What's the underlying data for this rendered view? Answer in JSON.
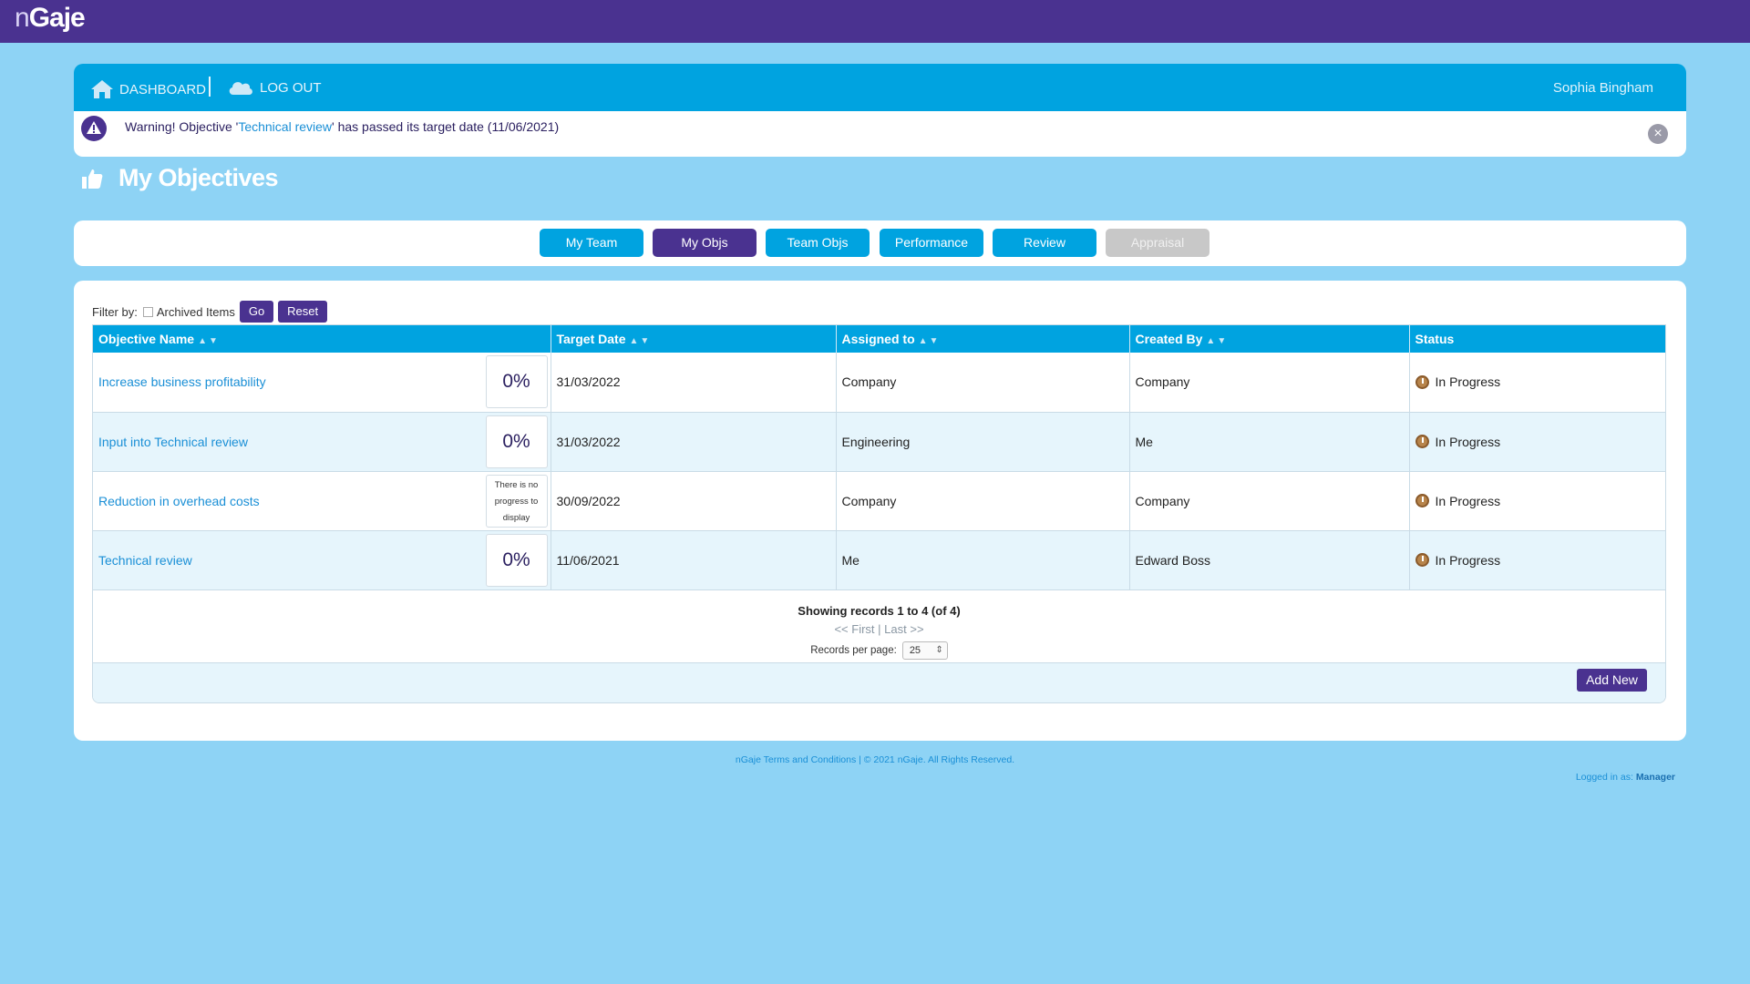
{
  "app": {
    "logo_n": "n",
    "logo_rest": "Gaje"
  },
  "nav": {
    "dashboard": "DASHBOARD",
    "logout": "LOG OUT",
    "user": "Sophia Bingham"
  },
  "warning": {
    "prefix": "Warning! Objective '",
    "link": "Technical review",
    "suffix": "' has passed its target date (11/06/2021)"
  },
  "page": {
    "title": "My Objectives"
  },
  "tabs": [
    {
      "label": "My Team",
      "state": "normal"
    },
    {
      "label": "My Objs",
      "state": "active"
    },
    {
      "label": "Team Objs",
      "state": "normal"
    },
    {
      "label": "Performance",
      "state": "normal"
    },
    {
      "label": "Review",
      "state": "normal"
    },
    {
      "label": "Appraisal",
      "state": "disabled"
    }
  ],
  "filter": {
    "label": "Filter by:",
    "archived": "Archived Items",
    "go": "Go",
    "reset": "Reset"
  },
  "table": {
    "headers": [
      "Objective Name",
      "Target Date",
      "Assigned to",
      "Created By",
      "Status"
    ],
    "rows": [
      {
        "name": "Increase business profitability",
        "progress": "0%",
        "date": "31/03/2022",
        "assigned": "Company",
        "created": "Company",
        "status": "In Progress"
      },
      {
        "name": "Input into Technical review",
        "progress": "0%",
        "date": "31/03/2022",
        "assigned": "Engineering",
        "created": "Me",
        "status": "In Progress"
      },
      {
        "name": "Reduction in overhead costs",
        "progress": "There is no progress to display",
        "date": "30/09/2022",
        "assigned": "Company",
        "created": "Company",
        "status": "In Progress"
      },
      {
        "name": "Technical review",
        "progress": "0%",
        "date": "11/06/2021",
        "assigned": "Me",
        "created": "Edward Boss",
        "status": "In Progress"
      }
    ]
  },
  "paging": {
    "records": "Showing records 1 to 4 (of 4)",
    "first": "<< First",
    "sep": "|",
    "last": "Last >>",
    "per_page_label": "Records per page:",
    "per_page_value": "25"
  },
  "actions": {
    "add_new": "Add New"
  },
  "footer": {
    "text": "nGaje Terms and Conditions  |  © 2021 nGaje. All Rights Reserved.",
    "logged_in_label": "Logged in as:",
    "logged_in_role": "Manager"
  },
  "colors": {
    "brand": "#4a3290",
    "accent": "#00a3e0",
    "background": "#8ed3f5"
  }
}
